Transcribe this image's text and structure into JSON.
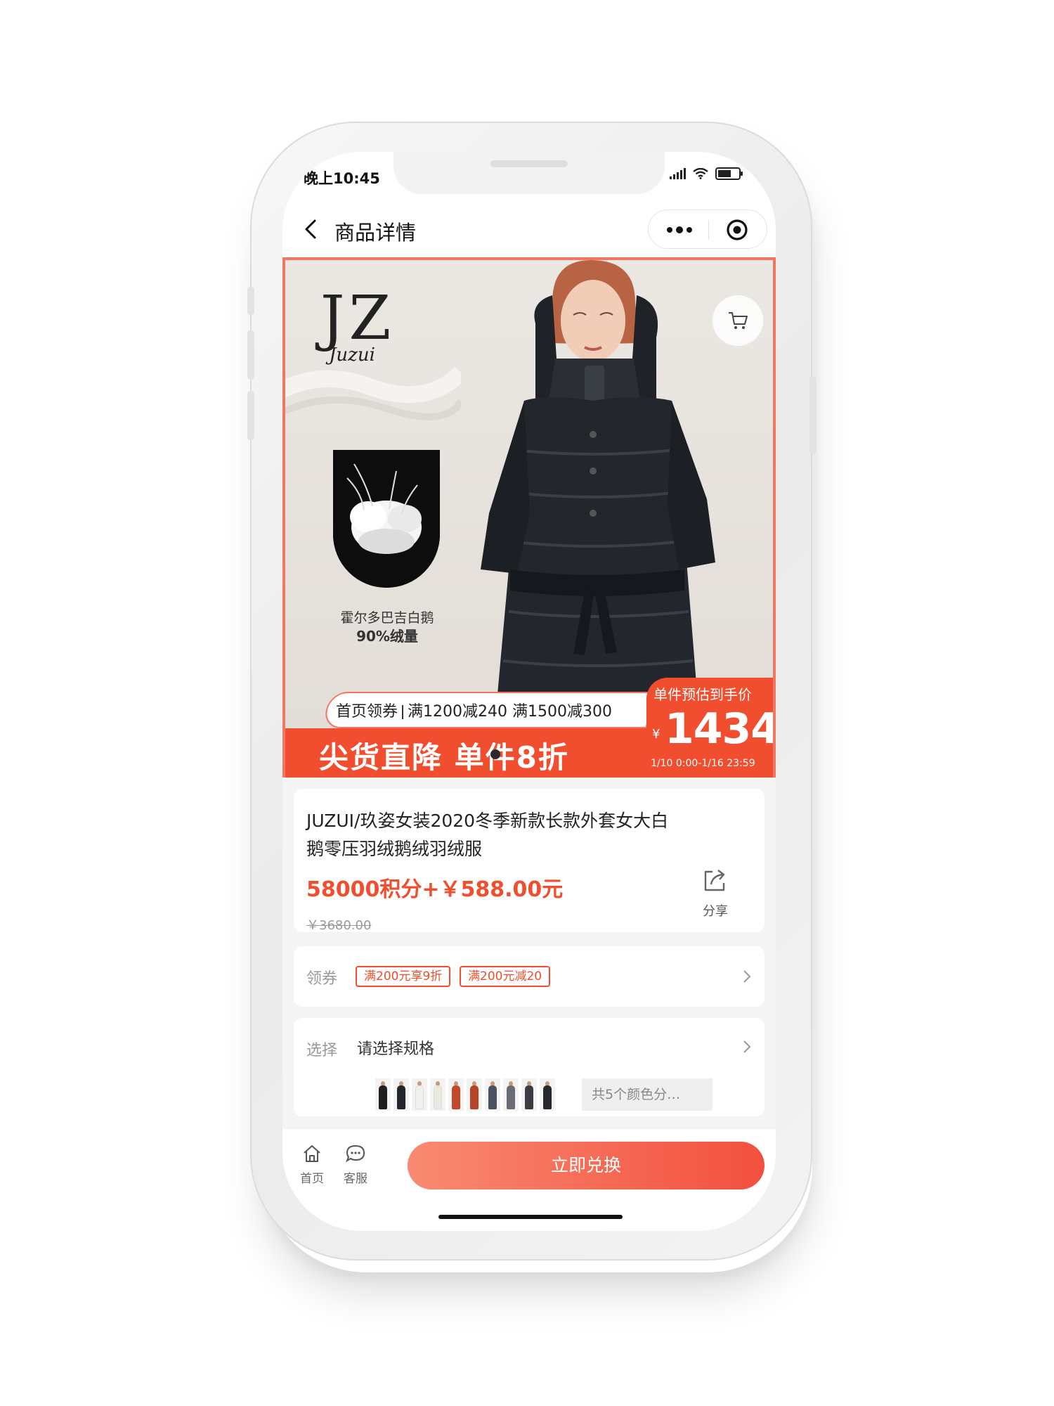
{
  "status_bar": {
    "time": "晚上10:45"
  },
  "navbar": {
    "title": "商品详情"
  },
  "banner": {
    "brand": "JZ",
    "brand_sub": "Juzui",
    "down_caption_line1": "霍尔多巴吉白鹅",
    "down_caption_line2": "90%绒量",
    "coupon_lead": "首页领券",
    "coupon_offers": "满1200减240 满1500减300",
    "headline": "尖货直降 单件8折",
    "estimate_label": "单件预估到手价",
    "currency": "¥",
    "estimate_price": "1434",
    "date_range": "1/10 0:00-1/16 23:59"
  },
  "product": {
    "title": "JUZUI/玖姿女装2020冬季新款长款外套女大白鹅零压羽绒鹅绒羽绒服",
    "price": "58000积分+￥588.00元",
    "original_price": "￥3680.00",
    "share_label": "分享"
  },
  "coupons": {
    "label": "领券",
    "tags": [
      "满200元享9折",
      "满200元减20"
    ]
  },
  "spec": {
    "label": "选择",
    "value": "请选择规格",
    "more_colors": "共5个颜色分…"
  },
  "bottom_bar": {
    "home_label": "首页",
    "service_label": "客服",
    "redeem_label": "立即兑换"
  },
  "colors": {
    "accent": "#f04e2e",
    "button_gradient_start": "#f98a72",
    "button_gradient_end": "#f2503e"
  },
  "icons": [
    "back-icon",
    "more-icon",
    "target-icon",
    "cart-icon",
    "share-icon",
    "chevron-right-icon",
    "home-icon",
    "chat-icon",
    "signal-icon",
    "wifi-icon",
    "battery-icon"
  ]
}
